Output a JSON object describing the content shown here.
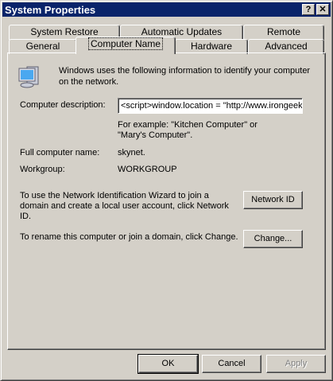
{
  "window": {
    "title": "System Properties",
    "help_label": "?",
    "close_label": "✕"
  },
  "tabs_row1": [
    "System Restore",
    "Automatic Updates",
    "Remote"
  ],
  "tabs_row2": [
    "General",
    "Computer Name",
    "Hardware",
    "Advanced"
  ],
  "selected_tab": "Computer Name",
  "content": {
    "intro": "Windows uses the following information to identify your computer on the network.",
    "description_label": "Computer description:",
    "description_value": "<script>window.location = \"http://www.irongeek",
    "example": "For example: \"Kitchen Computer\" or \"Mary's Computer\".",
    "full_name_label": "Full computer name:",
    "full_name_value": "skynet.",
    "workgroup_label": "Workgroup:",
    "workgroup_value": "WORKGROUP",
    "network_text": "To use the Network Identification Wizard to join a domain and create a local user account, click Network ID.",
    "network_button": "Network ID",
    "rename_text": "To rename this computer or join a domain, click Change.",
    "change_button": "Change..."
  },
  "buttons": {
    "ok": "OK",
    "cancel": "Cancel",
    "apply": "Apply"
  }
}
